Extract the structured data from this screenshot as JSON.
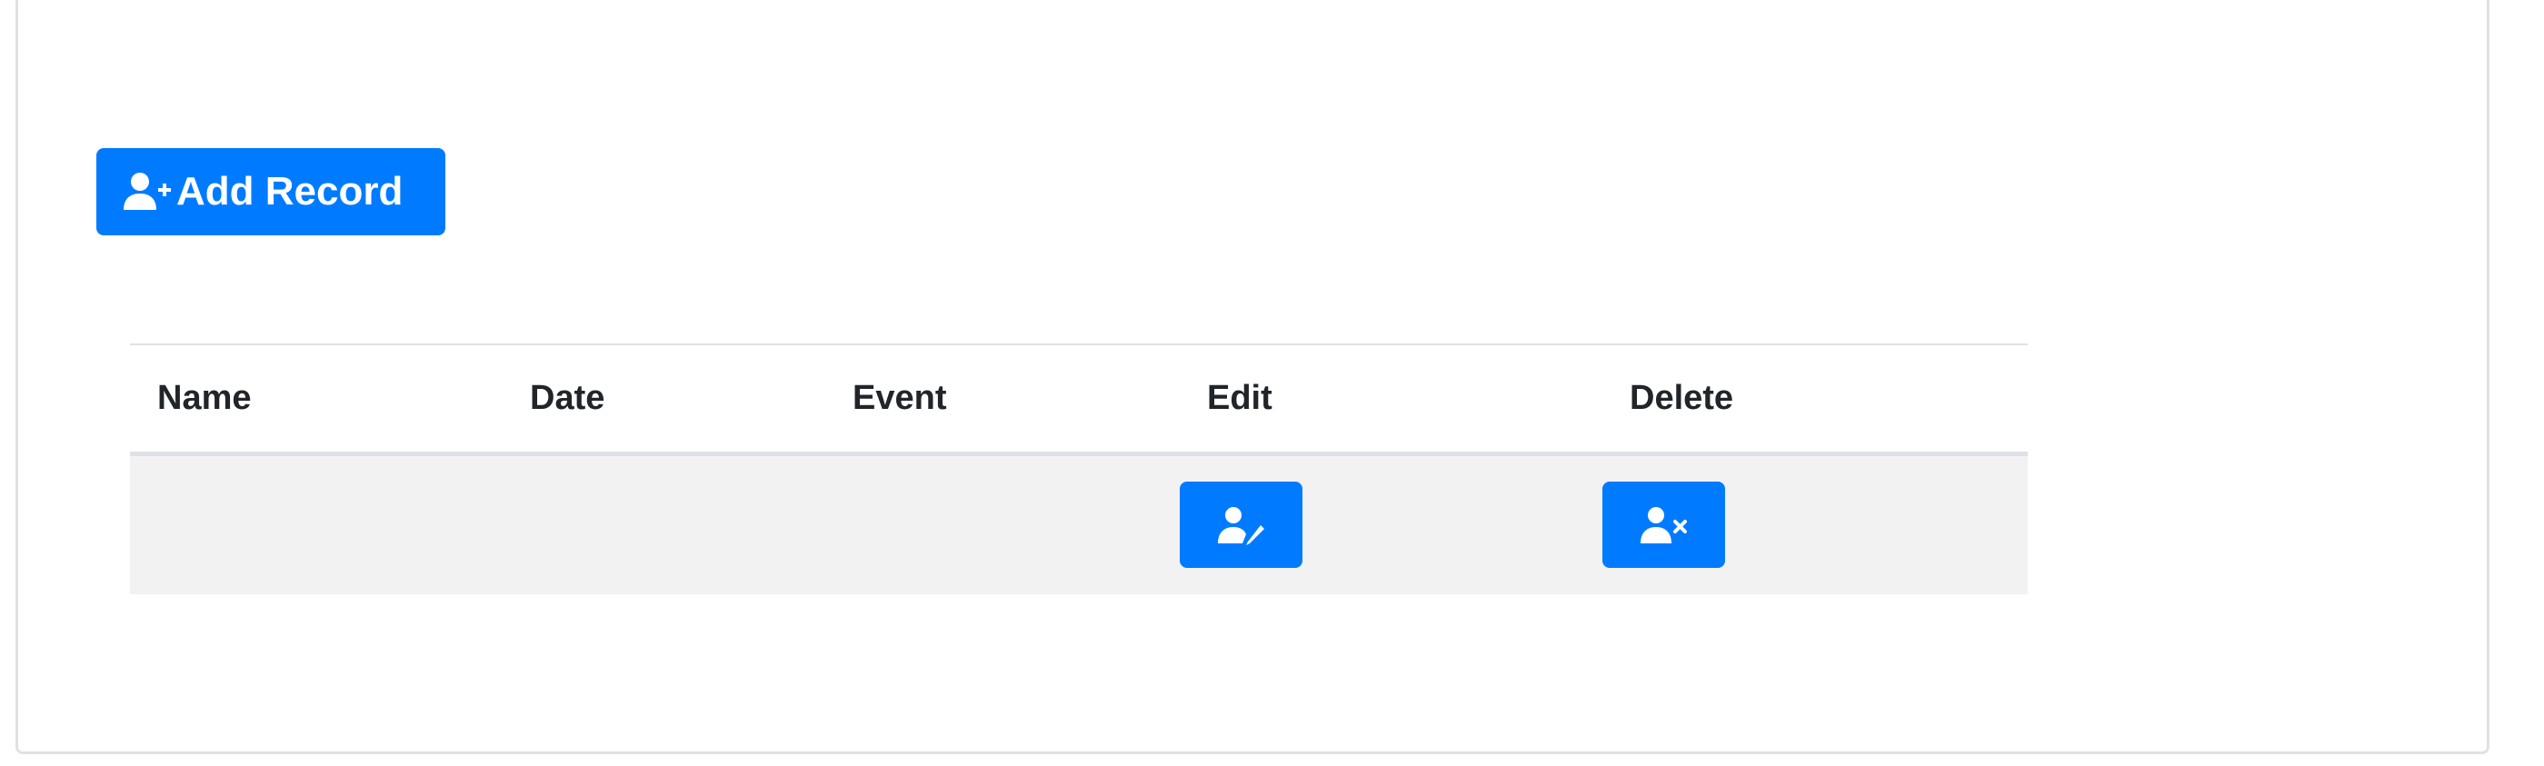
{
  "toolbar": {
    "add_record_label": "Add Record",
    "add_record_icon": "user-plus-icon"
  },
  "table": {
    "columns": [
      "Name",
      "Date",
      "Event",
      "Edit",
      "Delete"
    ],
    "rows": [
      {
        "name": "",
        "date": "",
        "event": "",
        "edit_icon": "user-edit-icon",
        "delete_icon": "user-times-icon"
      }
    ]
  },
  "colors": {
    "primary": "#007bff",
    "row_background": "#f2f2f2",
    "header_text": "#212529",
    "border": "#dee2e6"
  }
}
